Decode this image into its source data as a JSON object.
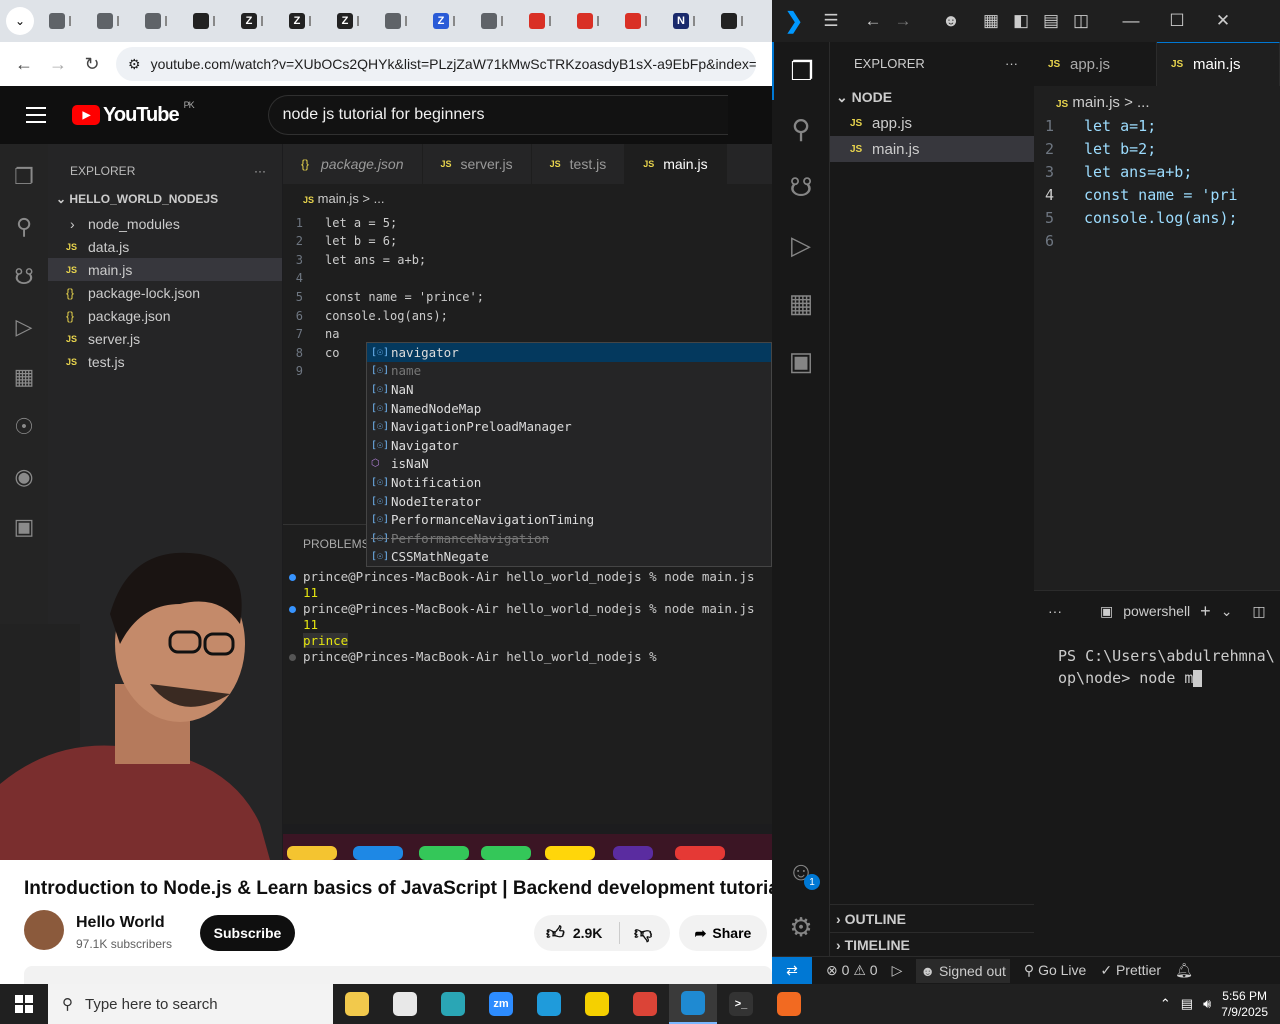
{
  "chrome": {
    "tabs": [
      {
        "icon": "bracket-box-icon",
        "color": "#5f6368"
      },
      {
        "icon": "bracket-box-icon",
        "color": "#5f6368"
      },
      {
        "icon": "globe-icon",
        "color": "#5f6368"
      },
      {
        "icon": "openai-icon",
        "color": "#222"
      },
      {
        "icon": "z-icon",
        "color": "#222"
      },
      {
        "icon": "z-icon",
        "color": "#222"
      },
      {
        "icon": "z-icon",
        "color": "#222"
      },
      {
        "icon": "globe-icon",
        "color": "#5f6368"
      },
      {
        "icon": "z-blue-icon",
        "color": "#2a5bd7"
      },
      {
        "icon": "globe-icon",
        "color": "#5f6368"
      },
      {
        "icon": "red-diamond-icon",
        "color": "#d93025"
      },
      {
        "icon": "red-diamond-icon",
        "color": "#d93025"
      },
      {
        "icon": "red-diamond-icon",
        "color": "#d93025"
      },
      {
        "icon": "n-blue-icon",
        "color": "#1a2a6c"
      },
      {
        "icon": "openai-icon",
        "color": "#222"
      }
    ],
    "tab_letters": [
      "",
      "",
      "",
      "",
      "Z",
      "Z",
      "Z",
      "",
      "Z",
      "",
      "",
      "",
      "",
      "N",
      ""
    ],
    "url": "youtube.com/watch?v=XUbOCs2QHYk&list=PLzjZaW71kMwScTRKzoasdyB1sX-a9EbFp&index=3"
  },
  "youtube": {
    "logo_text": "YouTube",
    "country": "PK",
    "search_value": "node js tutorial for beginners",
    "title": "Introduction to Node.js & Learn basics of JavaScript | Backend development tutorial",
    "channel": "Hello World",
    "subscribers": "97.1K subscribers",
    "subscribe_label": "Subscribe",
    "likes": "2.9K",
    "share_label": "Share"
  },
  "video": {
    "explorer_title": "EXPLORER",
    "folder": "HELLO_WORLD_NODEJS",
    "files": [
      {
        "type": "folder",
        "name": "node_modules"
      },
      {
        "type": "js",
        "name": "data.js"
      },
      {
        "type": "js",
        "name": "main.js",
        "selected": true
      },
      {
        "type": "json",
        "name": "package-lock.json"
      },
      {
        "type": "json",
        "name": "package.json"
      },
      {
        "type": "js",
        "name": "server.js"
      },
      {
        "type": "js",
        "name": "test.js"
      }
    ],
    "tabs": [
      {
        "name": "package.json",
        "kind": "json"
      },
      {
        "name": "server.js",
        "kind": "js"
      },
      {
        "name": "test.js",
        "kind": "js"
      },
      {
        "name": "main.js",
        "kind": "js",
        "active": true
      }
    ],
    "breadcrumb": "main.js > ...",
    "code_lines": [
      "let a = 5;",
      "let b = 6;",
      "let ans = a+b;",
      "",
      "const name = 'prince';",
      "console.log(ans);",
      "na",
      "co",
      ""
    ],
    "suggestions": [
      {
        "label": "navigator",
        "match": "na"
      },
      {
        "label": "name",
        "match": "na",
        "deprecated": false,
        "dim": true
      },
      {
        "label": "NaN",
        "match": "Na"
      },
      {
        "label": "NamedNodeMap",
        "match": "Na"
      },
      {
        "label": "NavigationPreloadManager",
        "match": "Na"
      },
      {
        "label": "Navigator",
        "match": "Na"
      },
      {
        "label": "isNaN",
        "match": "Na",
        "fn": true
      },
      {
        "label": "Notification",
        "match": "N"
      },
      {
        "label": "NodeIterator",
        "match": "N"
      },
      {
        "label": "PerformanceNavigationTiming",
        "match": "Na"
      },
      {
        "label": "PerformanceNavigation",
        "match": "Na",
        "deprecated": true
      },
      {
        "label": "CSSMathNegate",
        "match": "N"
      }
    ],
    "problems_label": "PROBLEMS",
    "terminal_lines": [
      {
        "text": "prince@Princes-MacBook-Air hello_world_nodejs % node main.js",
        "dot": true
      },
      {
        "text": "11",
        "dot": false
      },
      {
        "text": "prince@Princes-MacBook-Air hello_world_nodejs % node main.js",
        "dot": true
      },
      {
        "text": "11",
        "dot": false
      },
      {
        "text": "prince",
        "dot": false
      },
      {
        "text": "prince@Princes-MacBook-Air hello_world_nodejs % ",
        "dot": true
      }
    ]
  },
  "vscode": {
    "explorer_title": "EXPLORER",
    "folder": "NODE",
    "files": [
      {
        "name": "app.js"
      },
      {
        "name": "main.js",
        "selected": true
      }
    ],
    "tabs": [
      {
        "name": "app.js"
      },
      {
        "name": "main.js",
        "active": true
      }
    ],
    "breadcrumb": "main.js > ...",
    "code_lines": [
      "let a=1;",
      "let b=2;",
      "let ans=a+b;",
      "const name = 'pri",
      "console.log(ans);",
      ""
    ],
    "current_line": 4,
    "terminal_name": "powershell",
    "terminal_lines": [
      "PS C:\\Users\\abdulrehmna\\",
      "op\\node> node m"
    ],
    "outline_label": "OUTLINE",
    "timeline_label": "TIMELINE",
    "accounts_badge": "1",
    "status": {
      "errors": "0",
      "warnings": "0",
      "signed_out": "Signed out",
      "go_live": "Go Live",
      "prettier": "Prettier"
    }
  },
  "taskbar": {
    "search_placeholder": "Type here to search",
    "apps": [
      {
        "name": "file-explorer",
        "color": "#f2c94c",
        "label": ""
      },
      {
        "name": "paint",
        "color": "#e8e8e8",
        "label": ""
      },
      {
        "name": "store",
        "color": "#2aa6b5",
        "label": ""
      },
      {
        "name": "zoom",
        "color": "#2d8cff",
        "label": "zm"
      },
      {
        "name": "edge",
        "color": "#1f9bdb",
        "label": ""
      },
      {
        "name": "sticky-notes",
        "color": "#f5d000",
        "label": ""
      },
      {
        "name": "chrome",
        "color": "#db4437",
        "label": ""
      },
      {
        "name": "vscode",
        "color": "#1f8ad2",
        "label": "",
        "active": true
      },
      {
        "name": "terminal",
        "color": "#333",
        "label": ">_"
      },
      {
        "name": "other-app",
        "color": "#f26a21",
        "label": ""
      }
    ],
    "time": "5:56 PM",
    "date": "7/9/2025"
  }
}
